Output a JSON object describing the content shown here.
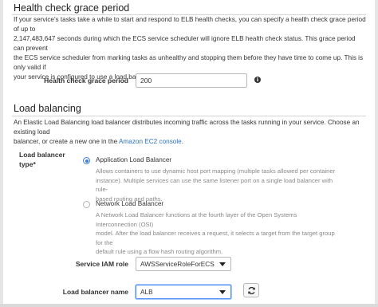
{
  "health_check": {
    "title": "Health check grace period",
    "description_lines": [
      "If your service's tasks take a while to start and respond to ELB health checks, you can specify a health check grace period of up to",
      "2,147,483,647 seconds during which the ECS service scheduler will ignore ELB health check status. This grace period can prevent",
      "the ECS service scheduler from marking tasks as unhealthy and stopping them before they have time to come up. This is only valid if",
      "your service is configured to use a load balancer."
    ],
    "field_label": "Health check grace period",
    "field_value": "200",
    "info_icon": "info-icon"
  },
  "load_balancing": {
    "title": "Load balancing",
    "description_line1": "An Elastic Load Balancing load balancer distributes incoming traffic across the tasks running in your service. Choose an existing load",
    "description_line2_prefix": "balancer, or create a new one in the ",
    "description_link": "Amazon EC2 console",
    "description_line2_suffix": ".",
    "type_label_line1": "Load balancer",
    "type_label_line2": "type*",
    "options": [
      {
        "label": "Application Load Balancer",
        "selected": true,
        "desc_lines": [
          "Allows containers to use dynamic host port mapping (multiple tasks allowed per container",
          "instance). Multiple services can use the same listener port on a single load balancer with rule-",
          "based routing and paths."
        ]
      },
      {
        "label": "Network Load Balancer",
        "selected": false,
        "desc_lines": [
          "A Network Load Balancer functions at the fourth layer of the Open Systems Interconnection (OSI)",
          "model. After the load balancer receives a request, it selects a target from the target group for the",
          "default rule using a flow hash routing algorithm."
        ]
      }
    ],
    "iam_role_label": "Service IAM role",
    "iam_role_value": "AWSServiceRoleForECS",
    "lb_name_label": "Load balancer name",
    "lb_name_value": "ALB",
    "refresh_icon": "refresh-icon"
  },
  "colors": {
    "link": "#2b72c4",
    "radio_selected": "#3b7ddb"
  }
}
